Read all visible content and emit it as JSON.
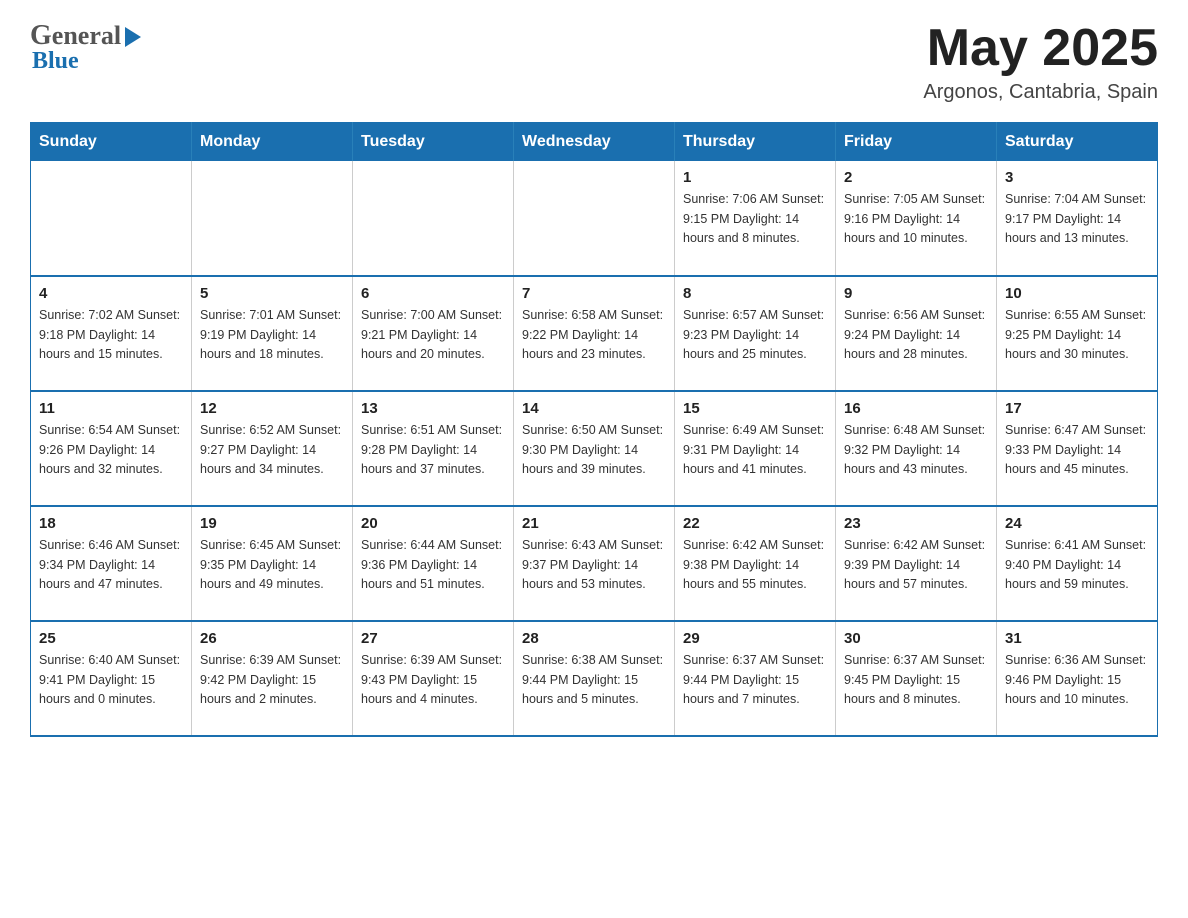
{
  "header": {
    "logo_general": "General",
    "logo_blue": "Blue",
    "month_year": "May 2025",
    "location": "Argonos, Cantabria, Spain"
  },
  "days_of_week": [
    "Sunday",
    "Monday",
    "Tuesday",
    "Wednesday",
    "Thursday",
    "Friday",
    "Saturday"
  ],
  "weeks": [
    [
      {
        "day": "",
        "info": ""
      },
      {
        "day": "",
        "info": ""
      },
      {
        "day": "",
        "info": ""
      },
      {
        "day": "",
        "info": ""
      },
      {
        "day": "1",
        "info": "Sunrise: 7:06 AM\nSunset: 9:15 PM\nDaylight: 14 hours and 8 minutes."
      },
      {
        "day": "2",
        "info": "Sunrise: 7:05 AM\nSunset: 9:16 PM\nDaylight: 14 hours and 10 minutes."
      },
      {
        "day": "3",
        "info": "Sunrise: 7:04 AM\nSunset: 9:17 PM\nDaylight: 14 hours and 13 minutes."
      }
    ],
    [
      {
        "day": "4",
        "info": "Sunrise: 7:02 AM\nSunset: 9:18 PM\nDaylight: 14 hours and 15 minutes."
      },
      {
        "day": "5",
        "info": "Sunrise: 7:01 AM\nSunset: 9:19 PM\nDaylight: 14 hours and 18 minutes."
      },
      {
        "day": "6",
        "info": "Sunrise: 7:00 AM\nSunset: 9:21 PM\nDaylight: 14 hours and 20 minutes."
      },
      {
        "day": "7",
        "info": "Sunrise: 6:58 AM\nSunset: 9:22 PM\nDaylight: 14 hours and 23 minutes."
      },
      {
        "day": "8",
        "info": "Sunrise: 6:57 AM\nSunset: 9:23 PM\nDaylight: 14 hours and 25 minutes."
      },
      {
        "day": "9",
        "info": "Sunrise: 6:56 AM\nSunset: 9:24 PM\nDaylight: 14 hours and 28 minutes."
      },
      {
        "day": "10",
        "info": "Sunrise: 6:55 AM\nSunset: 9:25 PM\nDaylight: 14 hours and 30 minutes."
      }
    ],
    [
      {
        "day": "11",
        "info": "Sunrise: 6:54 AM\nSunset: 9:26 PM\nDaylight: 14 hours and 32 minutes."
      },
      {
        "day": "12",
        "info": "Sunrise: 6:52 AM\nSunset: 9:27 PM\nDaylight: 14 hours and 34 minutes."
      },
      {
        "day": "13",
        "info": "Sunrise: 6:51 AM\nSunset: 9:28 PM\nDaylight: 14 hours and 37 minutes."
      },
      {
        "day": "14",
        "info": "Sunrise: 6:50 AM\nSunset: 9:30 PM\nDaylight: 14 hours and 39 minutes."
      },
      {
        "day": "15",
        "info": "Sunrise: 6:49 AM\nSunset: 9:31 PM\nDaylight: 14 hours and 41 minutes."
      },
      {
        "day": "16",
        "info": "Sunrise: 6:48 AM\nSunset: 9:32 PM\nDaylight: 14 hours and 43 minutes."
      },
      {
        "day": "17",
        "info": "Sunrise: 6:47 AM\nSunset: 9:33 PM\nDaylight: 14 hours and 45 minutes."
      }
    ],
    [
      {
        "day": "18",
        "info": "Sunrise: 6:46 AM\nSunset: 9:34 PM\nDaylight: 14 hours and 47 minutes."
      },
      {
        "day": "19",
        "info": "Sunrise: 6:45 AM\nSunset: 9:35 PM\nDaylight: 14 hours and 49 minutes."
      },
      {
        "day": "20",
        "info": "Sunrise: 6:44 AM\nSunset: 9:36 PM\nDaylight: 14 hours and 51 minutes."
      },
      {
        "day": "21",
        "info": "Sunrise: 6:43 AM\nSunset: 9:37 PM\nDaylight: 14 hours and 53 minutes."
      },
      {
        "day": "22",
        "info": "Sunrise: 6:42 AM\nSunset: 9:38 PM\nDaylight: 14 hours and 55 minutes."
      },
      {
        "day": "23",
        "info": "Sunrise: 6:42 AM\nSunset: 9:39 PM\nDaylight: 14 hours and 57 minutes."
      },
      {
        "day": "24",
        "info": "Sunrise: 6:41 AM\nSunset: 9:40 PM\nDaylight: 14 hours and 59 minutes."
      }
    ],
    [
      {
        "day": "25",
        "info": "Sunrise: 6:40 AM\nSunset: 9:41 PM\nDaylight: 15 hours and 0 minutes."
      },
      {
        "day": "26",
        "info": "Sunrise: 6:39 AM\nSunset: 9:42 PM\nDaylight: 15 hours and 2 minutes."
      },
      {
        "day": "27",
        "info": "Sunrise: 6:39 AM\nSunset: 9:43 PM\nDaylight: 15 hours and 4 minutes."
      },
      {
        "day": "28",
        "info": "Sunrise: 6:38 AM\nSunset: 9:44 PM\nDaylight: 15 hours and 5 minutes."
      },
      {
        "day": "29",
        "info": "Sunrise: 6:37 AM\nSunset: 9:44 PM\nDaylight: 15 hours and 7 minutes."
      },
      {
        "day": "30",
        "info": "Sunrise: 6:37 AM\nSunset: 9:45 PM\nDaylight: 15 hours and 8 minutes."
      },
      {
        "day": "31",
        "info": "Sunrise: 6:36 AM\nSunset: 9:46 PM\nDaylight: 15 hours and 10 minutes."
      }
    ]
  ]
}
